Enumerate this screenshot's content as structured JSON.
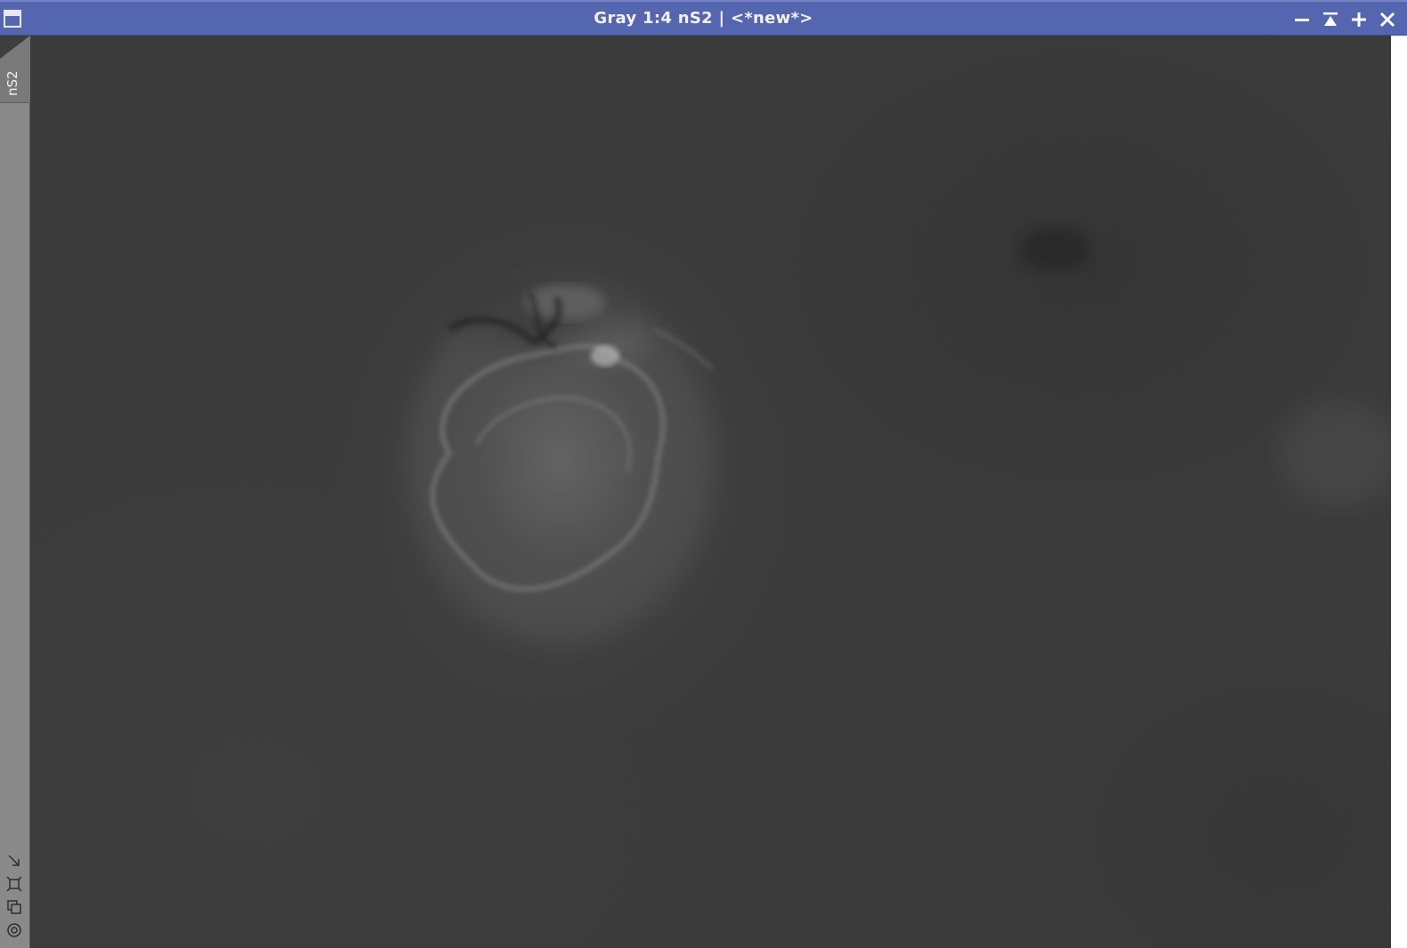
{
  "window": {
    "title": "Gray 1:4 nS2 | <*new*>"
  },
  "titlebar_buttons": {
    "minimize": "minimize-icon",
    "shade": "shade-icon",
    "maximize": "maximize-icon",
    "close": "close-icon"
  },
  "sidebar": {
    "view_tab_label": "nS2",
    "tools": [
      "resize-arrow-icon",
      "fit-view-icon",
      "clone-view-icon",
      "target-icon"
    ]
  },
  "colors": {
    "titlebar": "#5566b0",
    "sidebar": "#8a8a8a",
    "image_background": "#3b3b3b"
  }
}
